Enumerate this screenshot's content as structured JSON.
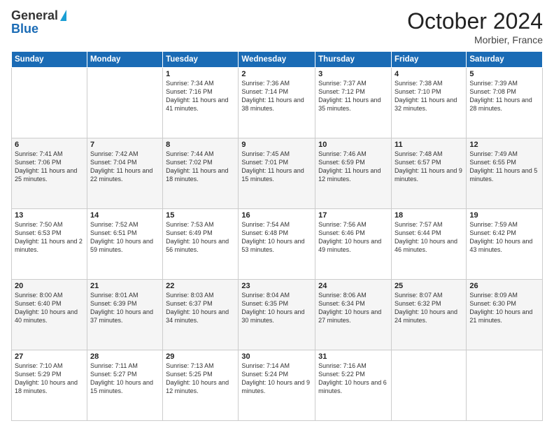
{
  "header": {
    "logo_general": "General",
    "logo_blue": "Blue",
    "month_title": "October 2024",
    "subtitle": "Morbier, France"
  },
  "days_of_week": [
    "Sunday",
    "Monday",
    "Tuesday",
    "Wednesday",
    "Thursday",
    "Friday",
    "Saturday"
  ],
  "weeks": [
    [
      {
        "day": "",
        "info": ""
      },
      {
        "day": "",
        "info": ""
      },
      {
        "day": "1",
        "info": "Sunrise: 7:34 AM\nSunset: 7:16 PM\nDaylight: 11 hours and 41 minutes."
      },
      {
        "day": "2",
        "info": "Sunrise: 7:36 AM\nSunset: 7:14 PM\nDaylight: 11 hours and 38 minutes."
      },
      {
        "day": "3",
        "info": "Sunrise: 7:37 AM\nSunset: 7:12 PM\nDaylight: 11 hours and 35 minutes."
      },
      {
        "day": "4",
        "info": "Sunrise: 7:38 AM\nSunset: 7:10 PM\nDaylight: 11 hours and 32 minutes."
      },
      {
        "day": "5",
        "info": "Sunrise: 7:39 AM\nSunset: 7:08 PM\nDaylight: 11 hours and 28 minutes."
      }
    ],
    [
      {
        "day": "6",
        "info": "Sunrise: 7:41 AM\nSunset: 7:06 PM\nDaylight: 11 hours and 25 minutes."
      },
      {
        "day": "7",
        "info": "Sunrise: 7:42 AM\nSunset: 7:04 PM\nDaylight: 11 hours and 22 minutes."
      },
      {
        "day": "8",
        "info": "Sunrise: 7:44 AM\nSunset: 7:02 PM\nDaylight: 11 hours and 18 minutes."
      },
      {
        "day": "9",
        "info": "Sunrise: 7:45 AM\nSunset: 7:01 PM\nDaylight: 11 hours and 15 minutes."
      },
      {
        "day": "10",
        "info": "Sunrise: 7:46 AM\nSunset: 6:59 PM\nDaylight: 11 hours and 12 minutes."
      },
      {
        "day": "11",
        "info": "Sunrise: 7:48 AM\nSunset: 6:57 PM\nDaylight: 11 hours and 9 minutes."
      },
      {
        "day": "12",
        "info": "Sunrise: 7:49 AM\nSunset: 6:55 PM\nDaylight: 11 hours and 5 minutes."
      }
    ],
    [
      {
        "day": "13",
        "info": "Sunrise: 7:50 AM\nSunset: 6:53 PM\nDaylight: 11 hours and 2 minutes."
      },
      {
        "day": "14",
        "info": "Sunrise: 7:52 AM\nSunset: 6:51 PM\nDaylight: 10 hours and 59 minutes."
      },
      {
        "day": "15",
        "info": "Sunrise: 7:53 AM\nSunset: 6:49 PM\nDaylight: 10 hours and 56 minutes."
      },
      {
        "day": "16",
        "info": "Sunrise: 7:54 AM\nSunset: 6:48 PM\nDaylight: 10 hours and 53 minutes."
      },
      {
        "day": "17",
        "info": "Sunrise: 7:56 AM\nSunset: 6:46 PM\nDaylight: 10 hours and 49 minutes."
      },
      {
        "day": "18",
        "info": "Sunrise: 7:57 AM\nSunset: 6:44 PM\nDaylight: 10 hours and 46 minutes."
      },
      {
        "day": "19",
        "info": "Sunrise: 7:59 AM\nSunset: 6:42 PM\nDaylight: 10 hours and 43 minutes."
      }
    ],
    [
      {
        "day": "20",
        "info": "Sunrise: 8:00 AM\nSunset: 6:40 PM\nDaylight: 10 hours and 40 minutes."
      },
      {
        "day": "21",
        "info": "Sunrise: 8:01 AM\nSunset: 6:39 PM\nDaylight: 10 hours and 37 minutes."
      },
      {
        "day": "22",
        "info": "Sunrise: 8:03 AM\nSunset: 6:37 PM\nDaylight: 10 hours and 34 minutes."
      },
      {
        "day": "23",
        "info": "Sunrise: 8:04 AM\nSunset: 6:35 PM\nDaylight: 10 hours and 30 minutes."
      },
      {
        "day": "24",
        "info": "Sunrise: 8:06 AM\nSunset: 6:34 PM\nDaylight: 10 hours and 27 minutes."
      },
      {
        "day": "25",
        "info": "Sunrise: 8:07 AM\nSunset: 6:32 PM\nDaylight: 10 hours and 24 minutes."
      },
      {
        "day": "26",
        "info": "Sunrise: 8:09 AM\nSunset: 6:30 PM\nDaylight: 10 hours and 21 minutes."
      }
    ],
    [
      {
        "day": "27",
        "info": "Sunrise: 7:10 AM\nSunset: 5:29 PM\nDaylight: 10 hours and 18 minutes."
      },
      {
        "day": "28",
        "info": "Sunrise: 7:11 AM\nSunset: 5:27 PM\nDaylight: 10 hours and 15 minutes."
      },
      {
        "day": "29",
        "info": "Sunrise: 7:13 AM\nSunset: 5:25 PM\nDaylight: 10 hours and 12 minutes."
      },
      {
        "day": "30",
        "info": "Sunrise: 7:14 AM\nSunset: 5:24 PM\nDaylight: 10 hours and 9 minutes."
      },
      {
        "day": "31",
        "info": "Sunrise: 7:16 AM\nSunset: 5:22 PM\nDaylight: 10 hours and 6 minutes."
      },
      {
        "day": "",
        "info": ""
      },
      {
        "day": "",
        "info": ""
      }
    ]
  ]
}
